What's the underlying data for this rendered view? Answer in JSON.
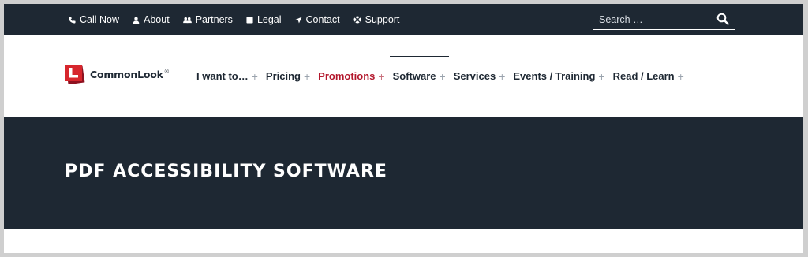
{
  "topbar": {
    "links": [
      {
        "label": "Call Now",
        "icon": "phone-icon"
      },
      {
        "label": "About",
        "icon": "person-icon"
      },
      {
        "label": "Partners",
        "icon": "people-icon"
      },
      {
        "label": "Legal",
        "icon": "document-icon"
      },
      {
        "label": "Contact",
        "icon": "send-arrow-icon"
      },
      {
        "label": "Support",
        "icon": "lifebuoy-icon"
      }
    ],
    "search": {
      "placeholder": "Search …",
      "value": ""
    }
  },
  "logo": {
    "name": "CommonLook",
    "mark": "®"
  },
  "nav": {
    "items": [
      {
        "label": "I want to…",
        "expand": "+"
      },
      {
        "label": "Pricing",
        "expand": "+"
      },
      {
        "label": "Promotions",
        "expand": "+"
      },
      {
        "label": "Software",
        "expand": "+"
      },
      {
        "label": "Services",
        "expand": "+"
      },
      {
        "label": "Events / Training",
        "expand": "+"
      },
      {
        "label": "Read / Learn",
        "expand": "+"
      }
    ]
  },
  "hero": {
    "title": "PDF ACCESSIBILITY SOFTWARE"
  },
  "colors": {
    "dark": "#1e2833",
    "brand_red": "#b3182d",
    "accent_red": "#d7262d"
  }
}
